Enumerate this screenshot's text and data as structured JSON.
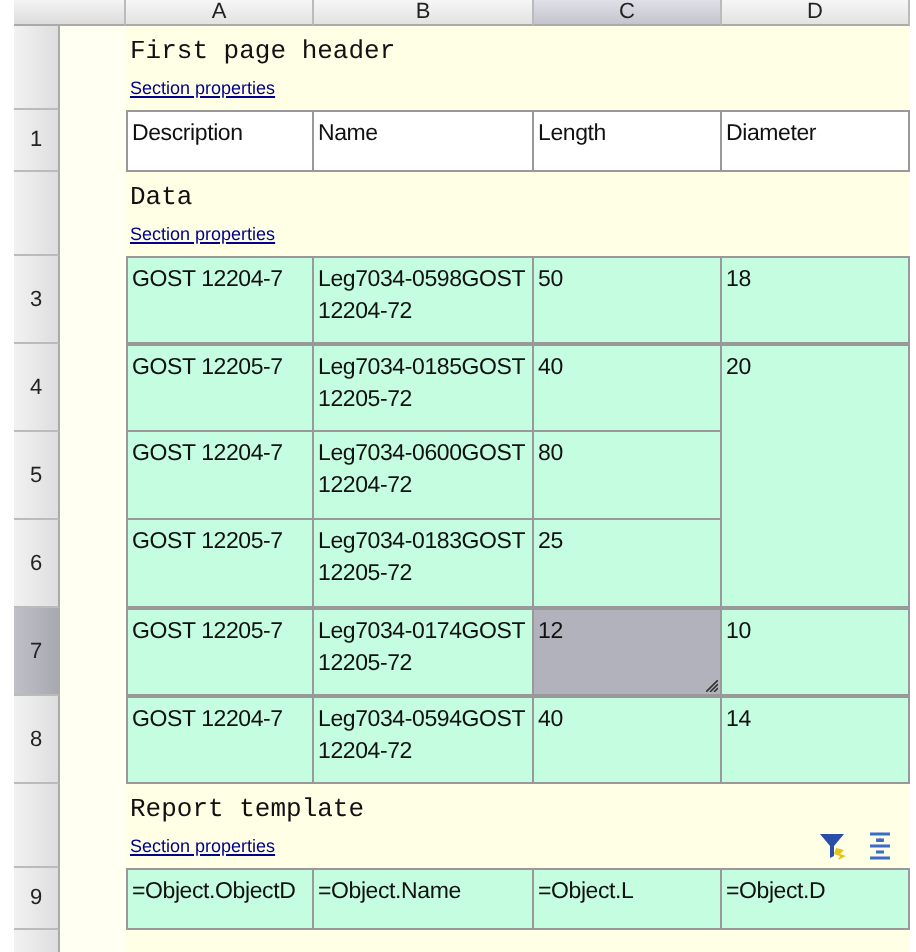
{
  "columns": [
    {
      "label": "A",
      "selected": false
    },
    {
      "label": "B",
      "selected": false
    },
    {
      "label": "C",
      "selected": true
    },
    {
      "label": "D",
      "selected": false
    }
  ],
  "sections": [
    {
      "kind": "header",
      "title": "First page header",
      "link": "Section properties",
      "groups": [
        {
          "last": "Diameter",
          "rows": [
            {
              "number": "1",
              "selected": false,
              "cells": [
                "Description",
                "Name",
                "Length"
              ]
            }
          ]
        }
      ]
    },
    {
      "kind": "data",
      "title": "Data",
      "link": "Section properties",
      "groups": [
        {
          "last": "18",
          "rows": [
            {
              "number": "3",
              "selected": false,
              "cells": [
                "GOST 12204-7",
                "Leg7034-0598GOST 12204-72",
                "50"
              ]
            }
          ]
        },
        {
          "last": "20",
          "rows": [
            {
              "number": "4",
              "selected": false,
              "cells": [
                "GOST 12205-7",
                "Leg7034-0185GOST 12205-72",
                "40"
              ]
            },
            {
              "number": "5",
              "selected": false,
              "cells": [
                "GOST 12204-7",
                "Leg7034-0600GOST 12204-72",
                "80"
              ]
            },
            {
              "number": "6",
              "selected": false,
              "cells": [
                "GOST 12205-7",
                "Leg7034-0183GOST 12205-72",
                "25"
              ]
            }
          ]
        },
        {
          "last": "10",
          "rows": [
            {
              "number": "7",
              "selected": true,
              "cells": [
                "GOST 12205-7",
                "Leg7034-0174GOST 12205-72",
                "12"
              ]
            }
          ]
        },
        {
          "last": "14",
          "rows": [
            {
              "number": "8",
              "selected": false,
              "cells": [
                "GOST 12204-7",
                "Leg7034-0594GOST 12204-72",
                "40"
              ]
            }
          ]
        }
      ]
    },
    {
      "kind": "template",
      "title": "Report template",
      "link": "Section properties",
      "groups": [
        {
          "last": "=Object.D",
          "rows": [
            {
              "number": "9",
              "selected": false,
              "cells": [
                "=Object.ObjectD",
                "=Object.Name",
                "=Object.L"
              ]
            }
          ]
        }
      ]
    }
  ]
}
